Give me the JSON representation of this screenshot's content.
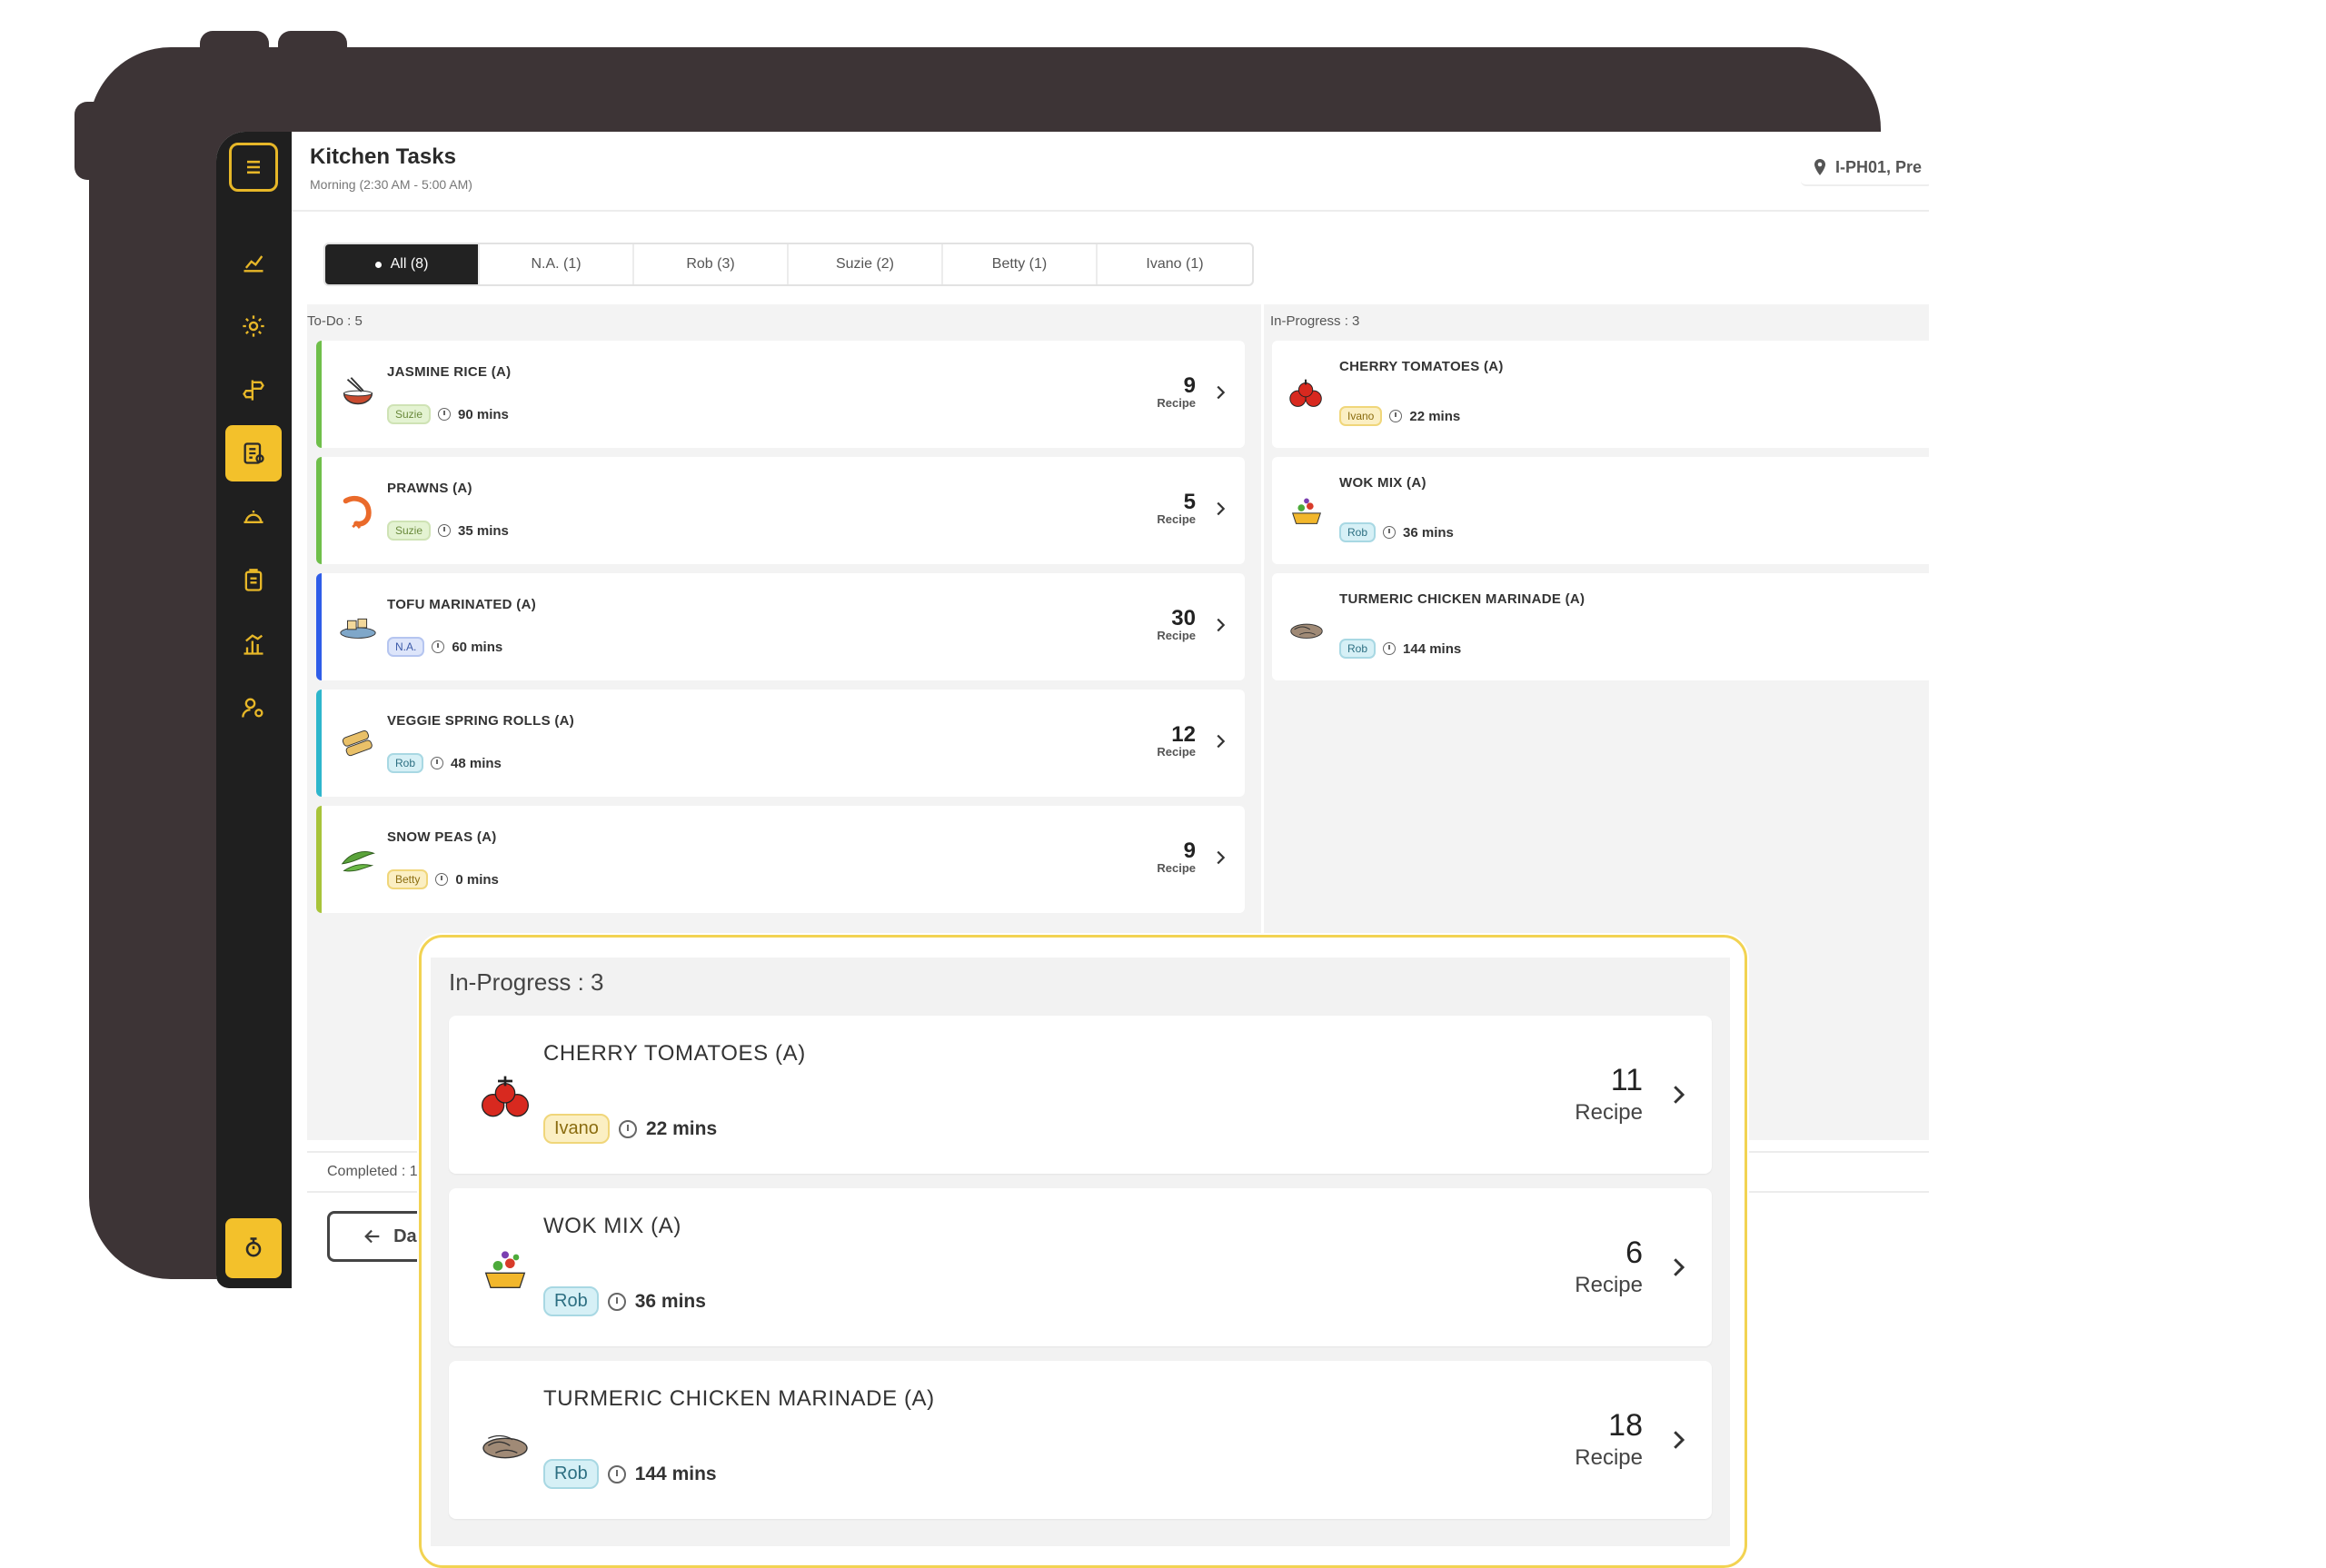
{
  "header": {
    "title": "Kitchen Tasks",
    "subtitle": "Morning (2:30 AM - 5:00 AM)",
    "location": "I-PH01, Pre"
  },
  "tabs": [
    {
      "label": "All (8)",
      "active": true
    },
    {
      "label": "N.A. (1)"
    },
    {
      "label": "Rob (3)"
    },
    {
      "label": "Suzie (2)"
    },
    {
      "label": "Betty (1)"
    },
    {
      "label": "Ivano (1)"
    }
  ],
  "todo": {
    "label": "To-Do : 5",
    "items": [
      {
        "name": "JASMINE RICE (A)",
        "assignee": "Suzie",
        "time": "90 mins",
        "count": "9",
        "unit": "Recipe",
        "icon": "rice-bowl-icon"
      },
      {
        "name": "PRAWNS (A)",
        "assignee": "Suzie",
        "time": "35 mins",
        "count": "5",
        "unit": "Recipe",
        "icon": "prawn-icon"
      },
      {
        "name": "TOFU MARINATED (A)",
        "assignee": "N.A.",
        "time": "60 mins",
        "count": "30",
        "unit": "Recipe",
        "icon": "tofu-icon"
      },
      {
        "name": "VEGGIE SPRING ROLLS (A)",
        "assignee": "Rob",
        "time": "48 mins",
        "count": "12",
        "unit": "Recipe",
        "icon": "spring-roll-icon"
      },
      {
        "name": "SNOW PEAS (A)",
        "assignee": "Betty",
        "time": "0 mins",
        "count": "9",
        "unit": "Recipe",
        "icon": "snow-peas-icon"
      }
    ]
  },
  "in_progress": {
    "label": "In-Progress : 3",
    "items": [
      {
        "name": "CHERRY TOMATOES (A)",
        "assignee": "Ivano",
        "time": "22 mins",
        "count": "11",
        "unit": "Recipe",
        "icon": "tomato-icon"
      },
      {
        "name": "WOK MIX (A)",
        "assignee": "Rob",
        "time": "36 mins",
        "count": "6",
        "unit": "Recipe",
        "icon": "wok-mix-icon"
      },
      {
        "name": "TURMERIC CHICKEN MARINADE (A)",
        "assignee": "Rob",
        "time": "144 mins",
        "count": "18",
        "unit": "Recipe",
        "icon": "chicken-icon"
      }
    ]
  },
  "completed": {
    "label": "Completed : 1"
  },
  "footer": {
    "daily_prep": "Daily Prep"
  },
  "colors": {
    "frame": "#3d3436",
    "sidebar": "#1f1f1f",
    "accent": "#f3c12b",
    "stripe_green": "#6fbf4a",
    "stripe_blue": "#2f5de8",
    "stripe_cyan": "#2eb6cc",
    "stripe_lime": "#a8c43a"
  }
}
